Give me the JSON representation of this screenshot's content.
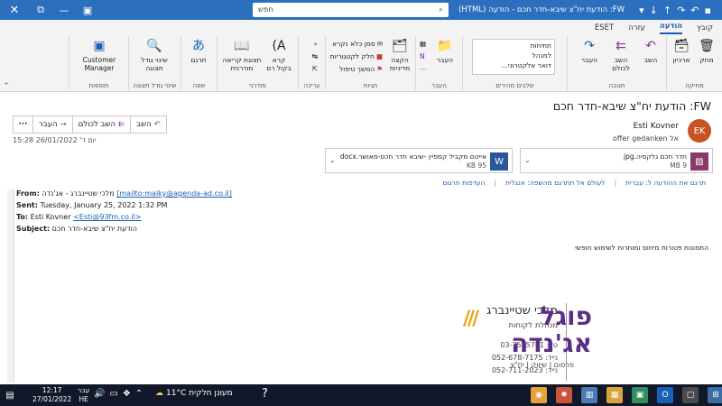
{
  "titlebar": {
    "title": "FW: הודעת יח\"צ שיבא-חדר חכם  -  הודעה (HTML)",
    "search_placeholder": "חפש",
    "quick_icons": [
      "save-icon",
      "undo-icon",
      "redo-icon",
      "up-arrow-icon",
      "down-arrow-icon",
      "customize-icon"
    ]
  },
  "tabs": [
    "קובץ",
    "הודעה",
    "עזרה",
    "ESET"
  ],
  "ribbon": {
    "groups": {
      "delete": {
        "label": "מחיקה",
        "delete": "מחק",
        "archive": "ארכיון"
      },
      "respond": {
        "label": "תגובה",
        "reply": "השב",
        "reply_all": "השב לכולם",
        "forward": "העבר"
      },
      "quick_steps": {
        "label": "שלבים מהירים",
        "items": [
          "תתיחות",
          "למנהל",
          "דואר אלקטרוני..."
        ]
      },
      "move": {
        "label": "העבר",
        "move": "העבר"
      },
      "tags": {
        "label": "תגיות",
        "assign": "הקצה מדיניות",
        "mark_unread": "סמן כלא נקרא",
        "categorize": "חלק לקטגוריות",
        "follow_up": "המשך טיפול"
      },
      "editing": {
        "label": "עריכה"
      },
      "immersive": {
        "label": "מודרני",
        "read_aloud": "קרא בקול רם",
        "immersive_reader": "תצוגת קריאה מודרנית"
      },
      "language": {
        "label": "שפה",
        "translate": "תרגם"
      },
      "zoom": {
        "label": "שינוי גודל תצוגה",
        "zoom": "שינוי גודל תצוגה"
      },
      "addins": {
        "label": "תוספות",
        "customer_manager": "Customer Manager"
      }
    }
  },
  "message": {
    "subject": "FW: הודעת יח\"צ שיבא-חדר חכם",
    "actions": {
      "reply": "השב",
      "reply_all": "השב לכולם",
      "forward": "העבר",
      "more": "···"
    },
    "sender_initials": "EK",
    "sender_name": "Esti Kovner",
    "to_label": "אל",
    "to_value": "offer gedanken",
    "datetime": "יום ד' 26/01/2022 15:28",
    "attachments": [
      {
        "name": "חדר חכם גלקסיה.jpg",
        "size": "9 MB",
        "icon": "image-icon",
        "color": "#8a3a6a"
      },
      {
        "name": "אייטם מקביל קמפיין -שיבא חדר חכם-מאושר.docx",
        "size": "95 KB",
        "icon": "word-icon",
        "color": "#2b579a"
      }
    ],
    "translation": {
      "translate": "תרגם את ההודעה ל: עברית",
      "never_translate": "לעולם אל תתרגם מהשפה: אנגלית",
      "prefs": "העדפות תרגום"
    },
    "header": {
      "from_label": "From:",
      "from_value": "מלכי שטיינברג - אג'נדה",
      "from_link": "[mailto:malky@agenda-ad.co.il]",
      "sent_label": "Sent:",
      "sent_value": "Tuesday, January 25, 2022 1:32 PM",
      "to_label": "To:",
      "to_value": "Esti Kovner",
      "to_link": "<Esti@93fm.co.il>",
      "subject_label": "Subject:",
      "subject_value": "הודעת יח\"צ שיבא-חדר חכם"
    },
    "images_note": "התמונות פטורות מיחוס ומותרות לשימוש חופשי",
    "signature": {
      "name": "מלכי שטיינברג",
      "role": "מנהלת לקוחות",
      "phone": "טל: 03-7525701",
      "mobile1": "נייד: 052-678-7175",
      "mobile2": "נייד: 052-711-2023",
      "logo_line1": "פוגל",
      "logo_line2": "אג'נדה",
      "logo_tagline": "פרסום | שיווק | יח\"צ"
    }
  },
  "taskbar": {
    "time": "12:17",
    "date": "27/01/2022",
    "lang_top": "עבר",
    "lang_bottom": "HE",
    "weather_temp": "11°C",
    "weather_text": "מעונן חלקית"
  }
}
